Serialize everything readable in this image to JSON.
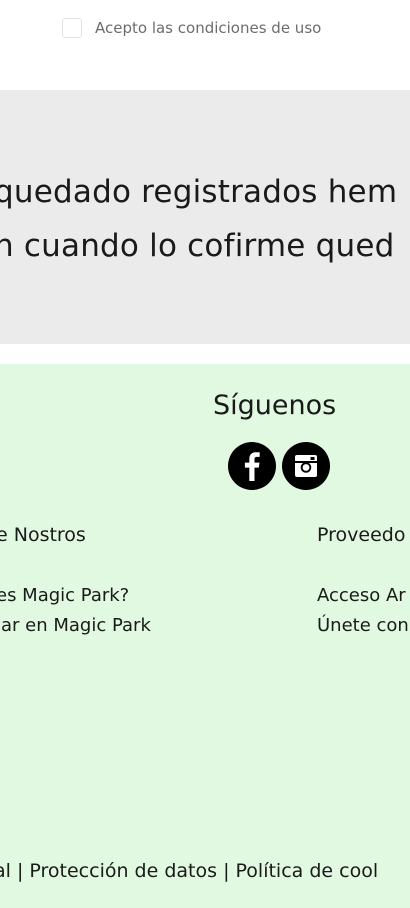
{
  "terms": {
    "label": "Acepto las condiciones de uso"
  },
  "notice": {
    "line1": "quedado registrados hem",
    "line2": "n cuando lo cofirme qued"
  },
  "footer": {
    "follow_title": "Síguenos",
    "social": [
      {
        "icon": "facebook-icon"
      },
      {
        "icon": "instagram-icon"
      }
    ],
    "about": {
      "title": "e Nostros",
      "links": [
        "es Magic Park?",
        "jar en Magic Park"
      ]
    },
    "providers": {
      "title": "Proveedo",
      "links": [
        "Acceso Ar",
        "Únete con"
      ]
    },
    "legal_text": "al | Protección de datos | Política de cool"
  },
  "colors": {
    "notice_bg": "#ebebeb",
    "footer_bg": "#e1f8e1",
    "social_bg": "#000000"
  }
}
